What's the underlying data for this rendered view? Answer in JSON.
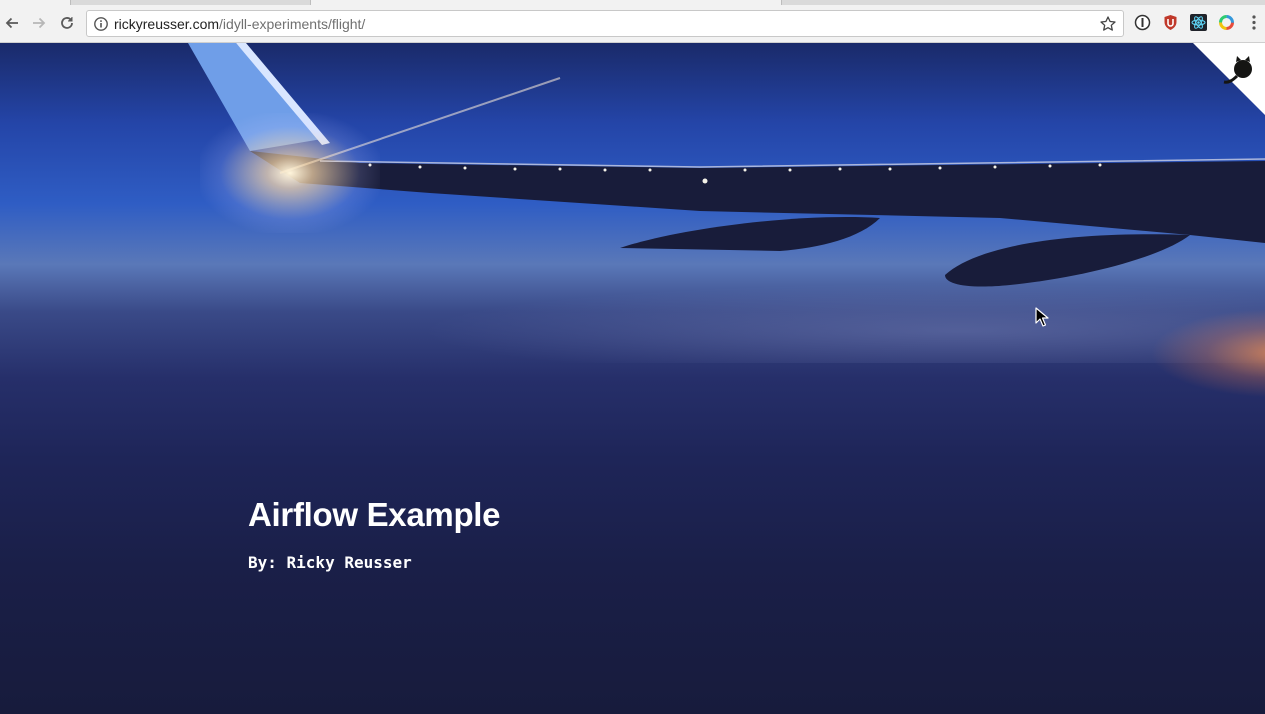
{
  "browser": {
    "url_host": "rickyreusser.com",
    "url_path": "/idyll-experiments/flight/",
    "icons": {
      "back": "back-arrow-icon",
      "forward": "forward-arrow-icon",
      "reload": "reload-icon",
      "info": "info-icon",
      "bookmark": "star-icon",
      "extensions": [
        "onepassword-icon",
        "ublock-icon",
        "react-devtools-icon",
        "colorpicker-icon",
        "menu-dots-icon"
      ]
    }
  },
  "page": {
    "title": "Airflow Example",
    "byline": "By: Ricky Reusser",
    "corner_icon": "github-octocat-icon"
  },
  "colors": {
    "sky_top": "#2445a8",
    "sunset_glow": "#ff9650",
    "text": "#ffffff"
  }
}
